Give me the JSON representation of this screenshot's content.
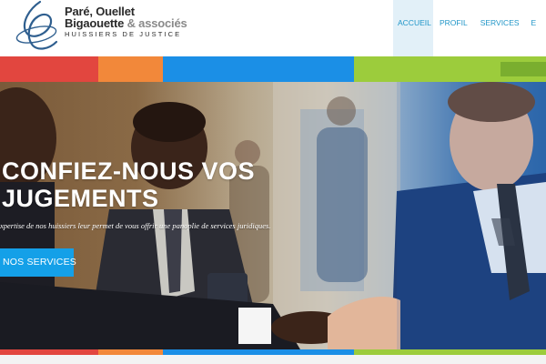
{
  "logo": {
    "line1": "Paré, Ouellet",
    "line2_name": "Bigaouette",
    "line2_amp": " & associés",
    "tagline": "HUISSIERS DE JUSTICE"
  },
  "nav": {
    "items": [
      {
        "label": "ACCUEIL",
        "active": true
      },
      {
        "label": "PROFIL",
        "active": false
      },
      {
        "label": "SERVICES",
        "active": false
      },
      {
        "label": "E",
        "active": false
      }
    ]
  },
  "colors": {
    "red": "#e2463f",
    "orange": "#f2883a",
    "blue": "#1b8fe6",
    "green": "#9ccc3c",
    "accent": "#14a0e8"
  },
  "hero": {
    "title": "Confiez-nous vos jugements",
    "subtitle": "xpertise de nos huissiers leur permet de vous offrir une panoplie de services juridiques.",
    "cta_label": "NOS SERVICES"
  }
}
